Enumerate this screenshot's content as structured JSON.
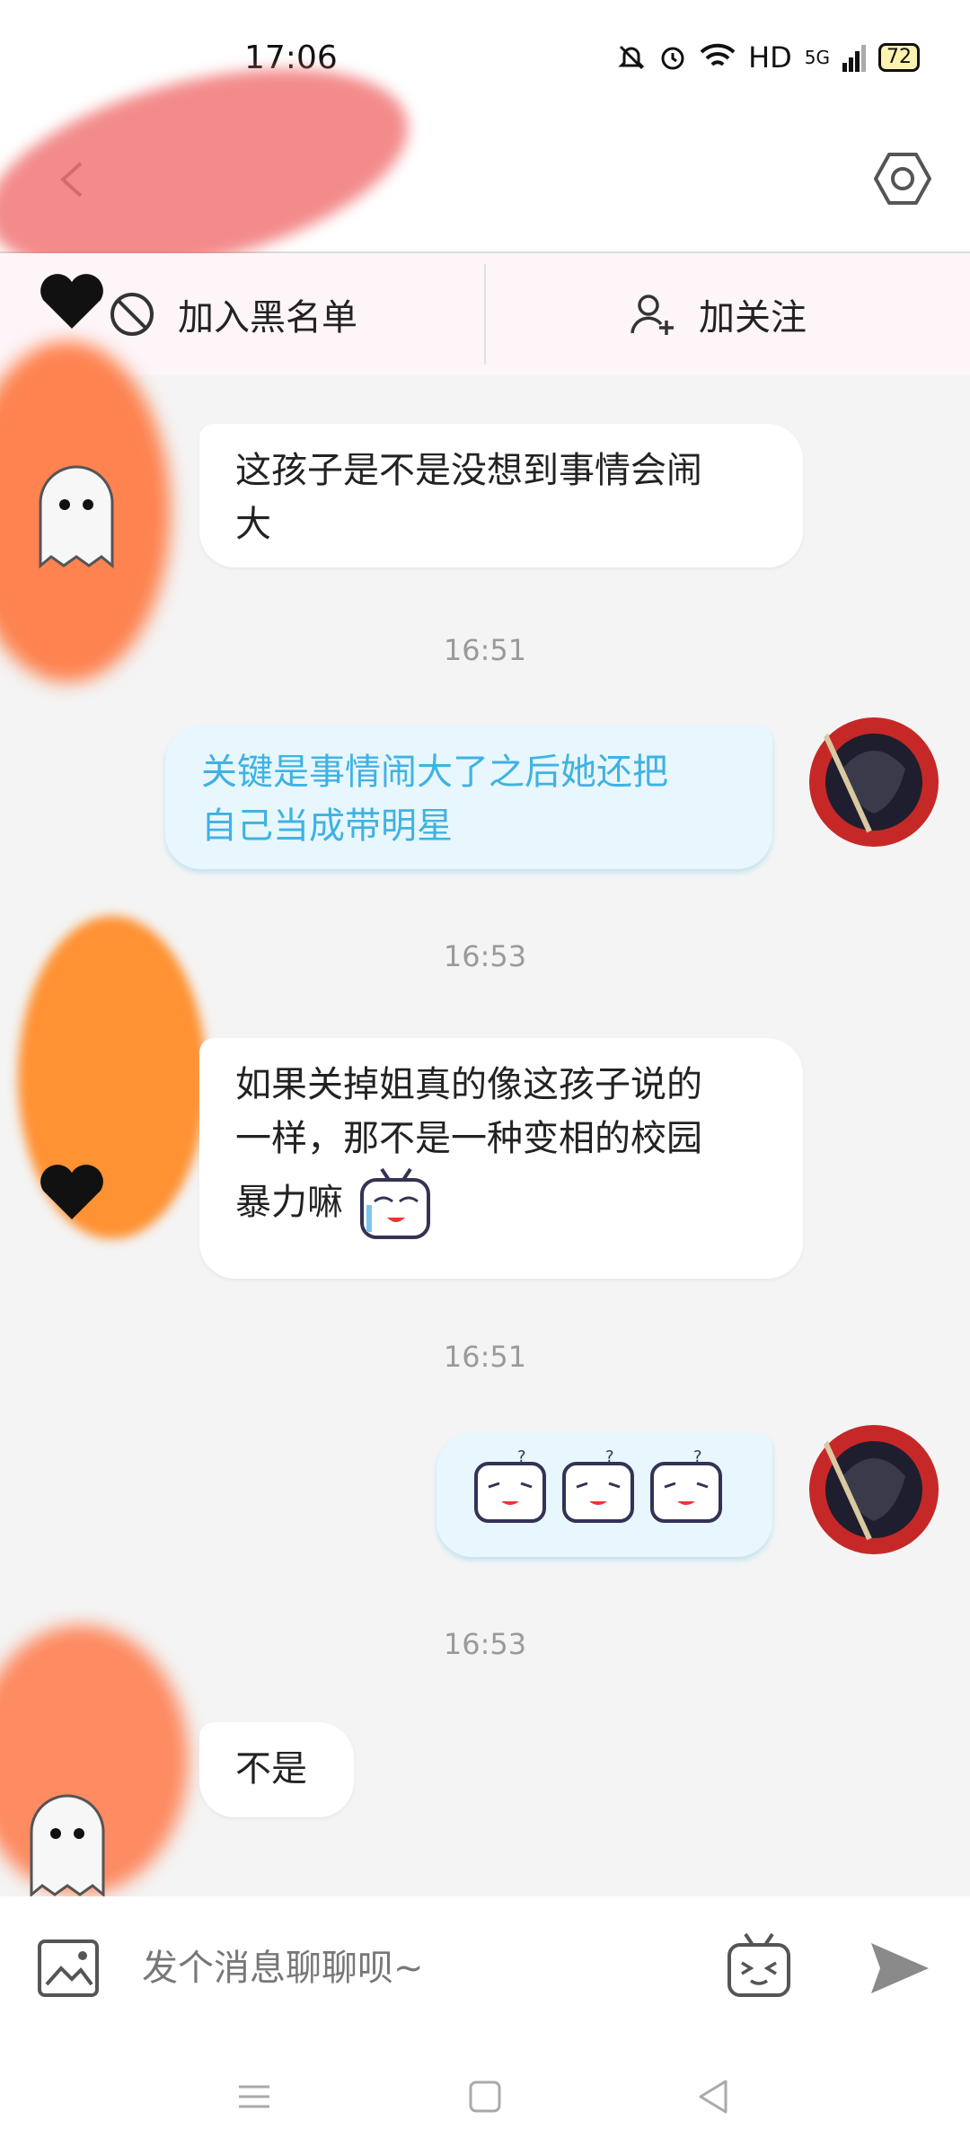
{
  "status_bar": {
    "time": "17:06",
    "network": "HD",
    "signal": "5G",
    "battery": "72"
  },
  "header": {
    "back_icon": "back-arrow-icon",
    "settings_icon": "hexagon-settings-icon"
  },
  "actions": {
    "block_label": "加入黑名单",
    "follow_label": "加关注"
  },
  "messages": [
    {
      "side": "in",
      "text_line1": "这孩子是不是没想到事情会闹",
      "text_line2": "大"
    },
    {
      "timestamp": "16:51"
    },
    {
      "side": "out",
      "text_line1": "关键是事情闹大了之后她还把",
      "text_line2": "自己当成带明星"
    },
    {
      "timestamp": "16:53"
    },
    {
      "side": "in",
      "text_line1": "如果关掉姐真的像这孩子说的",
      "text_line2": "一样，那不是一种变相的校园",
      "text_line3": "暴力嘛"
    },
    {
      "timestamp": "16:51"
    },
    {
      "side": "out",
      "emoji": "three-confused-tv-emoji"
    },
    {
      "timestamp": "16:53"
    },
    {
      "side": "in",
      "text_line1": "不是"
    }
  ],
  "input": {
    "placeholder": "发个消息聊聊呗~"
  },
  "colors": {
    "outgoing_text": "#3fb2e3",
    "outgoing_bubble": "#e8f7fd",
    "action_bar": "#fdf5f8"
  }
}
